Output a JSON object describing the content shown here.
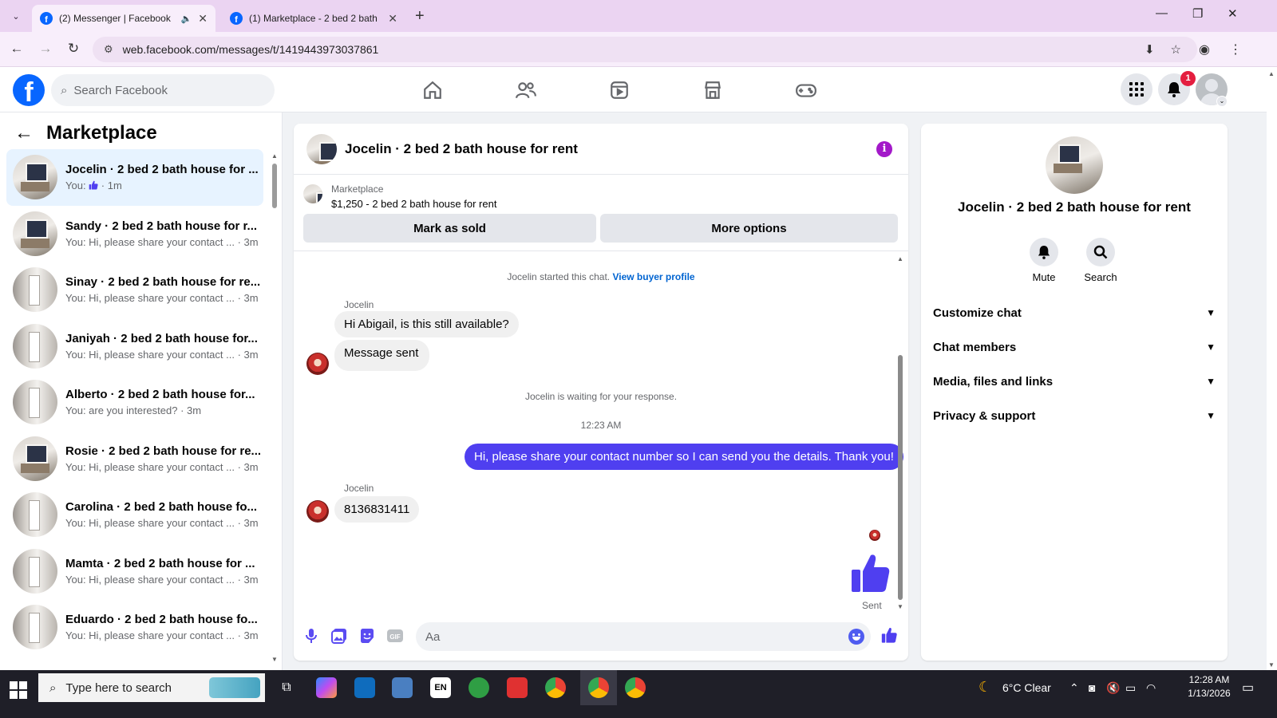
{
  "browser": {
    "tabs": [
      {
        "title": "(2) Messenger | Facebook",
        "active": true
      },
      {
        "title": "(1) Marketplace - 2 bed 2 bath",
        "active": false
      }
    ],
    "url": "web.facebook.com/messages/t/1419443973037861"
  },
  "header": {
    "search_placeholder": "Search Facebook",
    "notifications_count": "1",
    "nav_icons": [
      "home-icon",
      "friends-icon",
      "video-icon",
      "marketplace-icon",
      "gaming-icon"
    ]
  },
  "sidebar": {
    "title": "Marketplace",
    "conversations": [
      {
        "name": "Jocelin · 2 bed 2 bath house for ...",
        "snippet_prefix": "You: ",
        "snippet_suffix": " · 1m",
        "has_like": true,
        "avatar": "house",
        "active": true
      },
      {
        "name": "Sandy · 2 bed 2 bath house for r...",
        "snippet": "You: Hi, please share your contact ... · 3m",
        "avatar": "house"
      },
      {
        "name": "Sinay · 2 bed 2 bath house for re...",
        "snippet": "You: Hi, please share your contact ... · 3m",
        "avatar": "room"
      },
      {
        "name": "Janiyah · 2 bed 2 bath house for...",
        "snippet": "You: Hi, please share your contact ... · 3m",
        "avatar": "room"
      },
      {
        "name": "Alberto · 2 bed 2 bath house for...",
        "snippet": "You: are you interested? · 3m",
        "avatar": "room"
      },
      {
        "name": "Rosie · 2 bed 2 bath house for re...",
        "snippet": "You: Hi, please share your contact ... · 3m",
        "avatar": "house"
      },
      {
        "name": "Carolina · 2 bed 2 bath house fo...",
        "snippet": "You: Hi, please share your contact ... · 3m",
        "avatar": "room"
      },
      {
        "name": "Mamta · 2 bed 2 bath house for ...",
        "snippet": "You: Hi, please share your contact ... · 3m",
        "avatar": "room"
      },
      {
        "name": "Eduardo · 2 bed 2 bath house fo...",
        "snippet": "You: Hi, please share your contact ... · 3m",
        "avatar": "room"
      }
    ]
  },
  "chat": {
    "title": "Jocelin · 2 bed 2 bath house for rent",
    "listing": {
      "category": "Marketplace",
      "price_title": "$1,250 - 2 bed 2 bath house for rent",
      "mark_sold": "Mark as sold",
      "more_options": "More options"
    },
    "started_text": "Jocelin started this chat.",
    "view_buyer_profile": "View buyer profile",
    "sender_name": "Jocelin",
    "incoming_1": "Hi Abigail, is this still available?",
    "incoming_2": "Message sent",
    "waiting_text": "Jocelin is waiting for your response.",
    "timestamp": "12:23 AM",
    "outgoing_1": "Hi, please share your contact number so I can send you the details. Thank you!",
    "incoming_3": "8136831411",
    "sent_label": "Sent",
    "composer_placeholder": "Aa",
    "accent_color": "#4f3ff0"
  },
  "info_panel": {
    "name": "Jocelin · 2 bed 2 bath house for rent",
    "mute": "Mute",
    "search": "Search",
    "sections": [
      "Customize chat",
      "Chat members",
      "Media, files and links",
      "Privacy & support"
    ]
  },
  "taskbar": {
    "search_placeholder": "Type here to search",
    "weather": "6°C  Clear",
    "time": "12:28 AM",
    "date": "1/13/2026",
    "lang": "EN"
  }
}
